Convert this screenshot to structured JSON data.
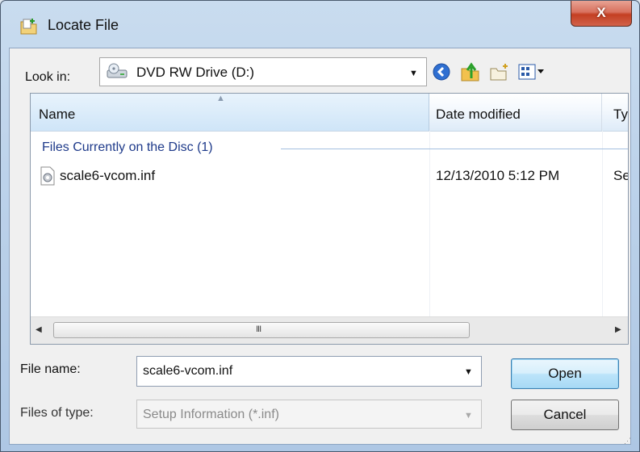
{
  "window": {
    "title": "Locate File",
    "close_label": "X"
  },
  "lookin": {
    "label": "Look in:",
    "value": "DVD RW Drive (D:)"
  },
  "toolbar": {
    "icons": [
      "back-icon",
      "up-folder-icon",
      "new-folder-icon",
      "view-menu-icon"
    ]
  },
  "list": {
    "columns": [
      "Name",
      "Date modified",
      "Ty"
    ],
    "group_header": "Files Currently on the Disc (1)",
    "files": [
      {
        "name": "scale6-vcom.inf",
        "date": "12/13/2010 5:12 PM",
        "type": "Se"
      }
    ],
    "scroll_grip": "III"
  },
  "form": {
    "filename_label": "File name:",
    "filename_value": "scale6-vcom.inf",
    "filetype_label": "Files of type:",
    "filetype_value": "Setup Information (*.inf)"
  },
  "buttons": {
    "open": "Open",
    "cancel": "Cancel"
  },
  "colors": {
    "accent": "#3c7fb1",
    "group_text": "#1e3a8a",
    "close_button": "#c33f22"
  }
}
